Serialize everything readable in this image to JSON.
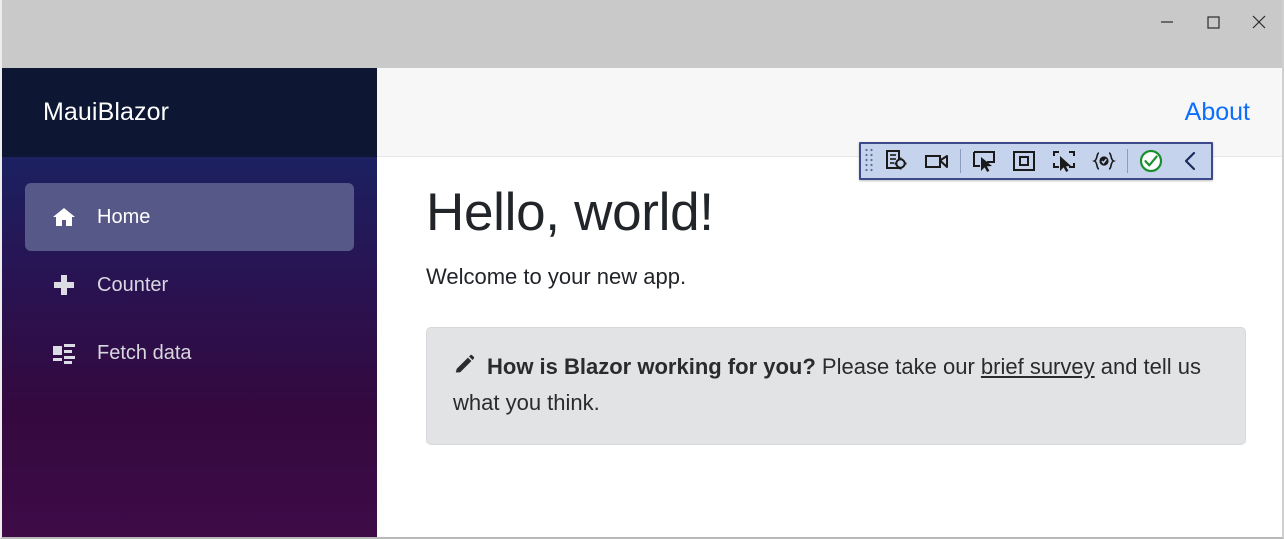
{
  "window": {
    "controls": [
      {
        "name": "minimize",
        "label": "Minimize",
        "glyph": "minimize-icon"
      },
      {
        "name": "maximize",
        "label": "Maximize",
        "glyph": "maximize-icon"
      },
      {
        "name": "close",
        "label": "Close",
        "glyph": "close-icon"
      }
    ]
  },
  "sidebar": {
    "brand": "MauiBlazor",
    "items": [
      {
        "label": "Home",
        "icon": "home-icon",
        "active": true
      },
      {
        "label": "Counter",
        "icon": "plus-icon",
        "active": false
      },
      {
        "label": "Fetch data",
        "icon": "list-rich-icon",
        "active": false
      }
    ]
  },
  "topbar": {
    "about_label": "About"
  },
  "main": {
    "title": "Hello, world!",
    "subtitle": "Welcome to your new app.",
    "survey": {
      "icon": "pencil-icon",
      "bold_text": "How is Blazor working for you?",
      "text_before_link": " Please take our ",
      "link_text": "brief survey",
      "text_after_link": " and tell us what you think."
    }
  },
  "devtoolbar": {
    "buttons": [
      {
        "name": "inspect-element",
        "icon": "inspect-element-icon"
      },
      {
        "name": "record-video",
        "icon": "video-camera-icon"
      },
      {
        "name": "select-element",
        "icon": "pointer-select-icon"
      },
      {
        "name": "highlight-box",
        "icon": "square-outline-icon"
      },
      {
        "name": "pick-region",
        "icon": "region-pointer-icon"
      },
      {
        "name": "braces-check",
        "icon": "braces-check-icon"
      },
      {
        "name": "status-ok",
        "icon": "check-circle-icon"
      },
      {
        "name": "collapse",
        "icon": "chevron-left-icon"
      }
    ]
  },
  "colors": {
    "accent_link": "#0d6efd",
    "brand_bg": "#0d1633",
    "nav_gradient_top": "#1b2161",
    "nav_gradient_bottom": "#3e0b47",
    "nav_active": "#565888",
    "titlebar": "#c9c9c9",
    "topbar": "#f7f7f7",
    "survey_bg": "#e2e3e5",
    "devtool_bg": "#c6d3ec",
    "devtool_border": "#3c4a8c",
    "status_ok_green": "#1a8f2e"
  }
}
